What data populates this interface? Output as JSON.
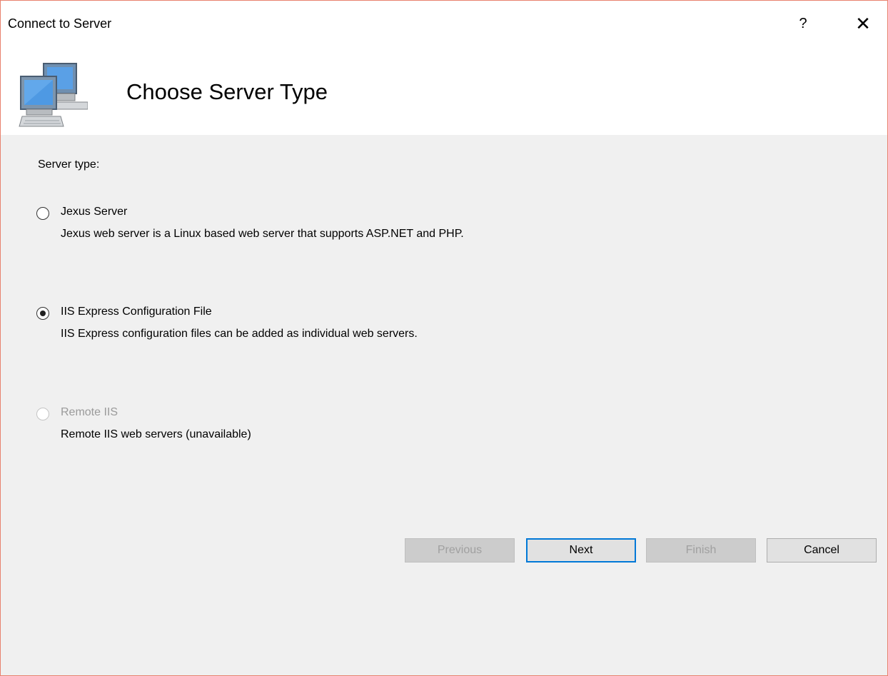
{
  "window": {
    "title": "Connect to Server",
    "help_label": "?",
    "close_label": "✕"
  },
  "header": {
    "title": "Choose Server Type",
    "icon": "networked-computers-icon"
  },
  "content": {
    "server_type_label": "Server type:",
    "options": [
      {
        "label": "Jexus Server",
        "description": "Jexus web server is a Linux based web server that supports ASP.NET and PHP.",
        "selected": false,
        "enabled": true
      },
      {
        "label": "IIS Express Configuration File",
        "description": "IIS Express configuration files can be added as individual web servers.",
        "selected": true,
        "enabled": true
      },
      {
        "label": "Remote IIS",
        "description": "Remote IIS web servers (unavailable)",
        "selected": false,
        "enabled": false
      }
    ]
  },
  "buttons": {
    "previous": "Previous",
    "next": "Next",
    "finish": "Finish",
    "cancel": "Cancel"
  },
  "colors": {
    "window_border": "#e8826e",
    "default_button_border": "#0078d7",
    "background": "#f0f0f0"
  }
}
